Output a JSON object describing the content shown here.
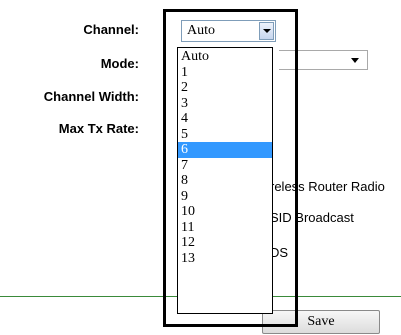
{
  "labels": {
    "channel": "Channel:",
    "mode": "Mode:",
    "channel_width": "Channel Width:",
    "max_tx_rate": "Max Tx Rate:"
  },
  "behind_text": {
    "radio": "reless Router Radio",
    "ssid": "SID Broadcast",
    "wds": "DS"
  },
  "channel": {
    "value": "Auto",
    "options": [
      "Auto",
      "1",
      "2",
      "3",
      "4",
      "5",
      "6",
      "7",
      "8",
      "9",
      "10",
      "11",
      "12",
      "13"
    ],
    "highlighted": "6"
  },
  "mode": {
    "value": ""
  },
  "buttons": {
    "save": "Save"
  },
  "colors": {
    "highlight": "#3399ff",
    "divider": "#3a8a3a",
    "frame": "#000000"
  }
}
